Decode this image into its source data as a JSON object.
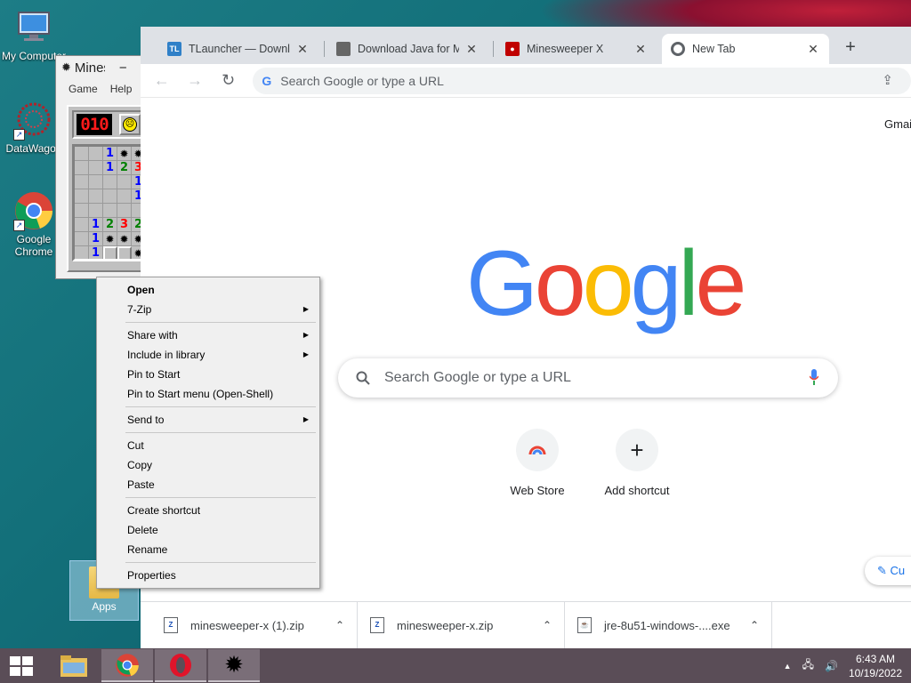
{
  "desktop": {
    "icons": [
      {
        "label": "My Computer"
      },
      {
        "label": "DataWagon"
      },
      {
        "label": "Google Chrome"
      }
    ],
    "apps_folder": {
      "label": "Apps"
    }
  },
  "minesweeper": {
    "title": "Minesweeper X",
    "menu": [
      "Game",
      "Help"
    ],
    "counter": "010",
    "face": "☹",
    "grid": [
      [
        "o",
        "o",
        "1",
        "m",
        "m",
        "o"
      ],
      [
        "o",
        "o",
        "1",
        "2",
        "3",
        "o"
      ],
      [
        "o",
        "o",
        "o",
        "o",
        "1",
        "o"
      ],
      [
        "o",
        "o",
        "o",
        "o",
        "1",
        "o"
      ],
      [
        "o",
        "o",
        "o",
        "o",
        "o",
        "o"
      ],
      [
        "o",
        "1",
        "2",
        "3",
        "2",
        "o"
      ],
      [
        "o",
        "1",
        "m",
        "m",
        "m",
        "o"
      ],
      [
        "o",
        "1",
        "c",
        "c",
        "m",
        "o"
      ]
    ]
  },
  "browser": {
    "tabs": [
      {
        "title": "TLauncher — Download",
        "favicon": "TL",
        "color": "#2f80c8"
      },
      {
        "title": "Download Java for Minecraft",
        "favicon": "box-icon",
        "color": "#555555"
      },
      {
        "title": "Minesweeper X",
        "favicon": "mine-icon",
        "color": "#c00000"
      },
      {
        "title": "New Tab",
        "favicon": "chrome-icon",
        "color": "#5f6368"
      }
    ],
    "omnibox_placeholder": "Search Google or type a URL",
    "gmail": "Gmai",
    "logo_letters": [
      {
        "ch": "G",
        "color": "#4285f4"
      },
      {
        "ch": "o",
        "color": "#ea4335"
      },
      {
        "ch": "o",
        "color": "#fbbc05"
      },
      {
        "ch": "g",
        "color": "#4285f4"
      },
      {
        "ch": "l",
        "color": "#34a853"
      },
      {
        "ch": "e",
        "color": "#ea4335"
      }
    ],
    "search_placeholder": "Search Google or type a URL",
    "shortcuts": [
      {
        "label": "Web Store"
      },
      {
        "label": "Add shortcut"
      }
    ],
    "customize": "Cu",
    "downloads": [
      {
        "name": "minesweeper-x (1).zip"
      },
      {
        "name": "minesweeper-x.zip"
      },
      {
        "name": "jre-8u51-windows-....exe"
      }
    ]
  },
  "context_menu": {
    "groups": [
      [
        {
          "label": "Open",
          "bold": true
        },
        {
          "label": "7-Zip",
          "submenu": true
        }
      ],
      [
        {
          "label": "Share with",
          "submenu": true
        },
        {
          "label": "Include in library",
          "submenu": true
        },
        {
          "label": "Pin to Start"
        },
        {
          "label": "Pin to Start menu (Open-Shell)"
        }
      ],
      [
        {
          "label": "Send to",
          "submenu": true
        }
      ],
      [
        {
          "label": "Cut"
        },
        {
          "label": "Copy"
        },
        {
          "label": "Paste"
        }
      ],
      [
        {
          "label": "Create shortcut"
        },
        {
          "label": "Delete"
        },
        {
          "label": "Rename"
        }
      ],
      [
        {
          "label": "Properties"
        }
      ]
    ]
  },
  "taskbar": {
    "time": "6:43 AM",
    "date": "10/19/2022"
  }
}
